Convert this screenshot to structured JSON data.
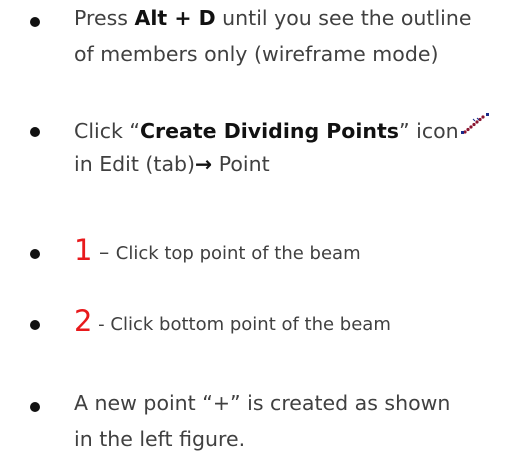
{
  "colors": {
    "text": "#404040",
    "bullet": "#111111",
    "emphasis_red": "#e8191c",
    "icon_dots": "#8a1530",
    "icon_marker": "#1a2a8a"
  },
  "items": [
    {
      "prefix": "Press ",
      "key": "Alt + D",
      "suffix": " until you see the outline",
      "line2": "of members only (wireframe mode)"
    },
    {
      "prefix": "Click “",
      "command": "Create Dividing Points",
      "suffix": "” icon",
      "icon": "create-dividing-points-icon",
      "line2_prefix": "in Edit (tab)",
      "arrow": "→",
      "line2_suffix": " Point"
    },
    {
      "number": "1",
      "dash": " – ",
      "text": "Click top point of the beam"
    },
    {
      "number": "2",
      "dash": " - ",
      "text": "Click bottom point of the beam"
    },
    {
      "line1": "A new point “+” is created as shown",
      "line2": "in the left figure."
    }
  ]
}
